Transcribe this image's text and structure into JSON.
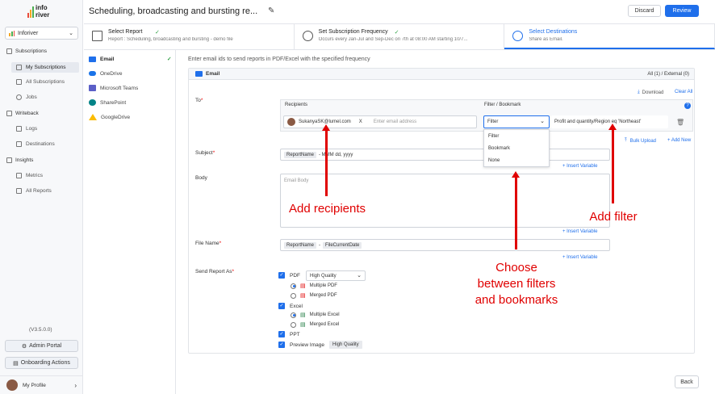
{
  "app": {
    "logo_line1": "info",
    "logo_line2": "river"
  },
  "workspace": {
    "name": "Inforiver"
  },
  "sidebar": {
    "sections": [
      {
        "label": "Subscriptions",
        "items": [
          "My Subscriptions",
          "All Subscriptions",
          "Jobs"
        ]
      },
      {
        "label": "Writeback",
        "items": [
          "Logs",
          "Destinations"
        ]
      },
      {
        "label": "Insights",
        "items": [
          "Metrics",
          "All Reports"
        ]
      }
    ],
    "version": "(V3.5.0.0)",
    "admin_portal": "Admin Portal",
    "onboarding": "Onboarding Actions",
    "profile": "My Profile"
  },
  "header": {
    "title": "Scheduling, broadcasting and bursting re...",
    "discard": "Discard",
    "review": "Review"
  },
  "steps": [
    {
      "title": "Select Report",
      "subtitle": "Report : Scheduling, broadcasting and bursting - demo file"
    },
    {
      "title": "Set Subscription Frequency",
      "subtitle": "Occurs every Jan-Jul and Sep-Dec on 7th at 08:00 AM starting 10/7..."
    },
    {
      "title": "Select Destinations",
      "subtitle": "Share as Email."
    }
  ],
  "destinations": [
    "Email",
    "OneDrive",
    "Microsoft Teams",
    "SharePoint",
    "GoogleDrive"
  ],
  "form": {
    "intro": "Enter email ids to send reports in PDF/Excel with the specified frequency",
    "section_title": "Email",
    "audience": "All (1) / External (0)",
    "download": "Download",
    "clear_all": "Clear All",
    "to_label": "To",
    "recipients_header": "Recipients",
    "filter_header": "Filter / Bookmark",
    "recipient_email": "SukanyaSK@lumel.com",
    "recipient_remove": "X",
    "email_placeholder": "Enter email address",
    "filter_selected": "Filter",
    "filter_options": [
      "Filter",
      "Bookmark",
      "None"
    ],
    "filter_value": "Profit and quantity/Region eq 'Northeast'",
    "bulk_upload": "Bulk Upload",
    "add_new": "+ Add New",
    "subject_label": "Subject",
    "subject_chip": "ReportName",
    "subject_rest": "- MMM dd, yyyy",
    "insert_variable": "+ Insert Variable",
    "body_label": "Body",
    "body_placeholder": "Email Body",
    "filename_label": "File Name",
    "filename_chip1": "ReportName",
    "filename_sep": "-",
    "filename_chip2": "FileCurrentDate",
    "send_as_label": "Send Report As",
    "pdf": "PDF",
    "pdf_quality": "High Quality",
    "multiple_pdf": "Multiple PDF",
    "merged_pdf": "Merged PDF",
    "excel": "Excel",
    "multiple_excel": "Multiple Excel",
    "merged_excel": "Merged Excel",
    "ppt": "PPT",
    "preview_image": "Preview Image",
    "preview_quality": "High Quality"
  },
  "footer": {
    "back": "Back"
  },
  "annotations": {
    "recipients": "Add recipients",
    "filter": "Add filter",
    "choose": [
      "Choose",
      "between filters",
      "and bookmarks"
    ]
  },
  "colors": {
    "accent": "#1f6feb",
    "annotation": "#e00000"
  }
}
